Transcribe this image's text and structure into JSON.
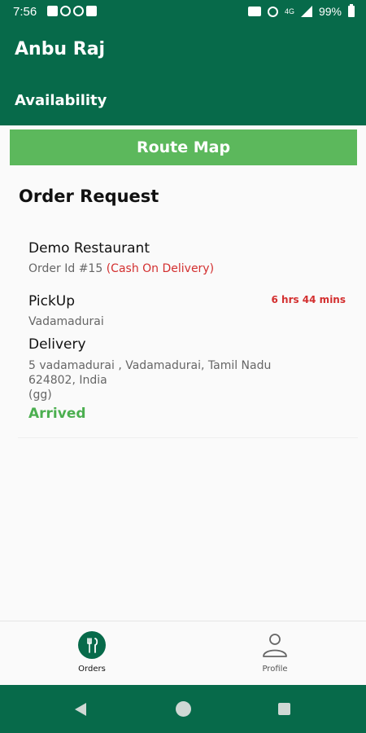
{
  "status_bar": {
    "time": "7:56",
    "network_label": "4G",
    "battery": "99%"
  },
  "header": {
    "user_name": "Anbu Raj",
    "availability_label": "Availability"
  },
  "route_map_button": "Route Map",
  "section_title": "Order Request",
  "order": {
    "restaurant": "Demo Restaurant",
    "order_id": "Order Id #15",
    "payment_method": "(Cash On Delivery)",
    "pickup_label": "PickUp",
    "time_remaining": "6 hrs 44 mins",
    "pickup_location": "Vadamadurai",
    "delivery_label": "Delivery",
    "delivery_address": "5 vadamadurai , Vadamadurai, Tamil Nadu 624802, India",
    "delivery_note": "(gg)",
    "status": "Arrived"
  },
  "bottom_nav": {
    "items": [
      {
        "label": "Orders",
        "icon": "cutlery-icon",
        "active": true
      },
      {
        "label": "Profile",
        "icon": "person-icon",
        "active": false
      }
    ]
  },
  "colors": {
    "primary": "#076a4a",
    "button": "#5cb85c",
    "alert": "#d32f2f",
    "success": "#4caf50"
  }
}
